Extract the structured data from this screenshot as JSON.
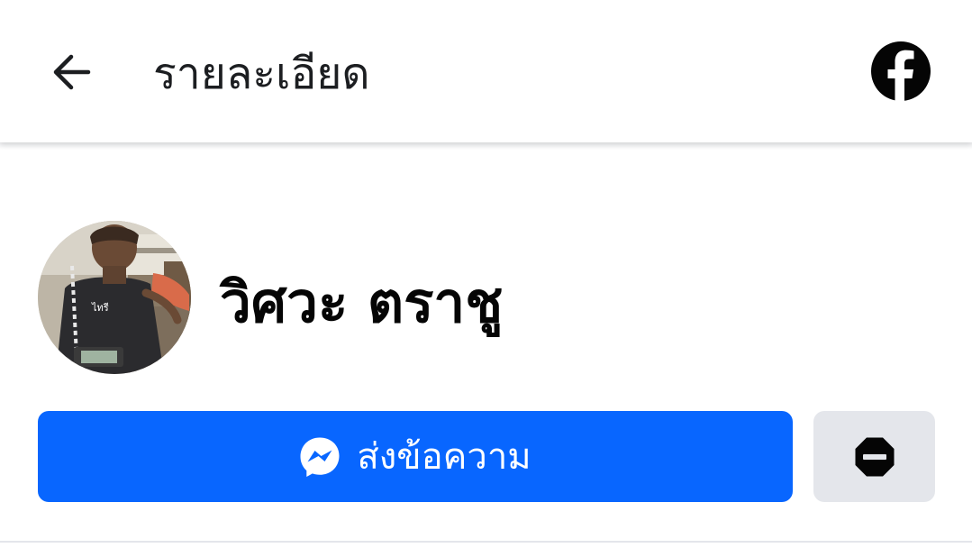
{
  "header": {
    "title": "รายละเอียด",
    "back_icon": "arrow-left-icon",
    "brand_icon": "facebook-icon"
  },
  "profile": {
    "name": "วิศวะ ตราชู",
    "avatar_icon": "profile-photo"
  },
  "actions": {
    "message_label": "ส่งข้อความ",
    "message_icon": "messenger-icon",
    "block_icon": "block-icon"
  },
  "colors": {
    "accent": "#0866ff",
    "secondary_button": "#e4e6eb",
    "text": "#050505",
    "title_text": "#1c1e21"
  }
}
